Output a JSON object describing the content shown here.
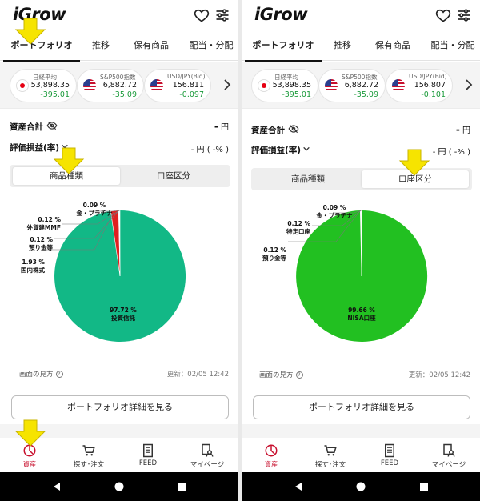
{
  "colors": {
    "accent_red": "#e60012",
    "positive_green": "#1a9a3a",
    "pie_investment_trust": "#12b886",
    "pie_nisa": "#22c021",
    "pie_domestic_stock": "#e02020",
    "arrow_yellow": "#f6e400"
  },
  "app": {
    "logo": "iGrow"
  },
  "icons": {
    "favorite": "heart-icon",
    "settings": "filter-sliders-icon"
  },
  "tabs": [
    "ポートフォリオ",
    "推移",
    "保有商品",
    "配当・分配"
  ],
  "screens": [
    {
      "tickers": [
        {
          "name": "日経平均",
          "value": "53,898.35",
          "change": "-395.01"
        },
        {
          "name": "S&P500指数",
          "value": "6,882.72",
          "change": "-35.09"
        },
        {
          "name": "USD/JPY(Bid)",
          "value": "156.811",
          "change": "-0.097"
        }
      ],
      "selected_segment": 0,
      "slices": [
        {
          "label": "投資信託",
          "percent": 97.72
        },
        {
          "label": "国内株式",
          "percent": 1.93
        },
        {
          "label": "預り金等",
          "percent": 0.12
        },
        {
          "label": "外貨建MMF",
          "percent": 0.12
        },
        {
          "label": "金・プラチナ",
          "percent": 0.09
        }
      ]
    },
    {
      "tickers": [
        {
          "name": "日経平均",
          "value": "53,898.35",
          "change": "-395.01"
        },
        {
          "name": "S&P500指数",
          "value": "6,882.72",
          "change": "-35.09"
        },
        {
          "name": "USD/JPY(Bid)",
          "value": "156.807",
          "change": "-0.101"
        }
      ],
      "selected_segment": 1,
      "slices": [
        {
          "label": "NISA口座",
          "percent": 99.66
        },
        {
          "label": "預り金等",
          "percent": 0.12
        },
        {
          "label": "特定口座",
          "percent": 0.12
        },
        {
          "label": "金・プラチナ",
          "percent": 0.09
        }
      ]
    }
  ],
  "summary": {
    "total_label": "資産合計",
    "total_value": "-",
    "total_unit": "円",
    "pl_label": "評価損益(率)",
    "pl_value": "- 円 ( -% )"
  },
  "segments": [
    "商品種類",
    "口座区分"
  ],
  "footer": {
    "how_to": "画面の見方",
    "updated": "更新：02/05 12:42"
  },
  "detail_button": "ポートフォリオ詳細を見る",
  "bottom_nav": [
    "資産",
    "探す･注文",
    "FEED",
    "マイページ"
  ]
}
